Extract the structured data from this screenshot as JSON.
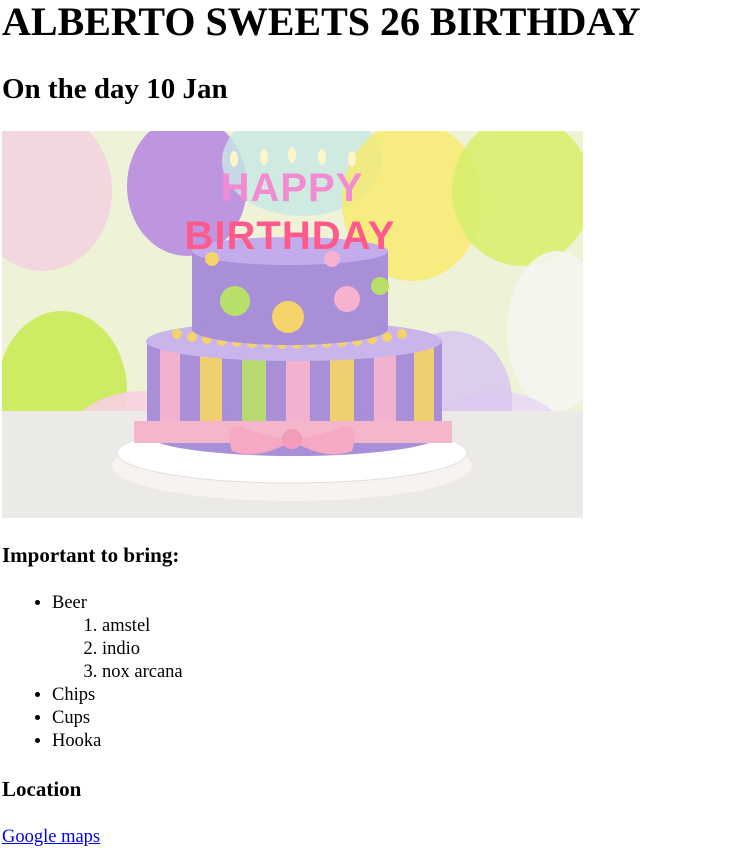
{
  "page": {
    "title": "ALBERTO SWEETS 26 BIRTHDAY",
    "subtitle": "On the day 10 Jan"
  },
  "hero_image": {
    "cake_topper": [
      "HAPPY",
      "BIRTHDAY"
    ],
    "colors": {
      "purple": "#a98fd8",
      "pink": "#f6b3cf",
      "yellow": "#f3d36a",
      "lime": "#b9df6b",
      "plate": "#f2eeec"
    }
  },
  "bring": {
    "heading": "Important to bring:",
    "items": [
      {
        "label": "Beer",
        "sub": [
          "amstel",
          "indio",
          "nox arcana"
        ]
      },
      {
        "label": "Chips"
      },
      {
        "label": "Cups"
      },
      {
        "label": "Hooka"
      }
    ]
  },
  "location": {
    "heading": "Location",
    "link_label": "Google maps"
  }
}
